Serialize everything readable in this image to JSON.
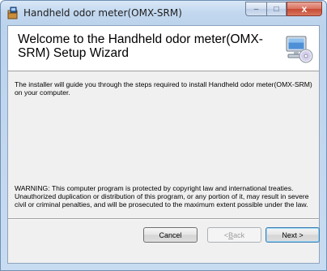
{
  "window": {
    "title": "Handheld odor meter(OMX-SRM)"
  },
  "caption": {
    "minimize": "–",
    "maximize": "□",
    "close": "x"
  },
  "banner": {
    "title": "Welcome to the Handheld odor meter(OMX-SRM) Setup Wizard",
    "icon": "computer-cd-icon"
  },
  "body": {
    "intro": "The installer will guide you through the steps required to install Handheld odor meter(OMX-SRM) on your computer.",
    "warning": "WARNING: This computer program is protected by copyright law and international treaties. Unauthorized duplication or distribution of this program, or any portion of it, may result in severe civil or criminal penalties, and will be prosecuted to the maximum extent possible under the law."
  },
  "buttons": {
    "cancel": "Cancel",
    "back_prefix": "< ",
    "back_hotkey": "B",
    "back_rest": "ack",
    "next": "Next >"
  }
}
